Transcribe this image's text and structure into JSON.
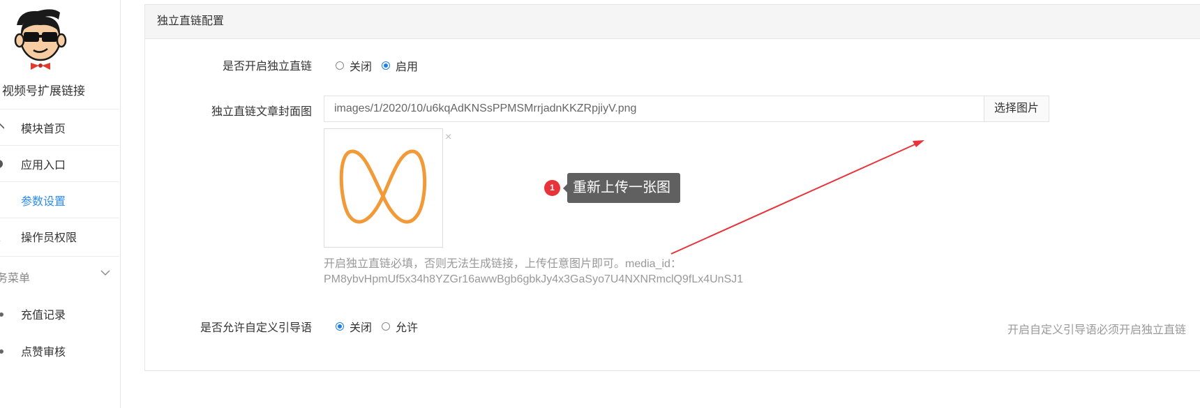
{
  "sidebar": {
    "app_name": "视频号扩展链接",
    "items": [
      {
        "label": "模块首页",
        "icon": "home-icon"
      },
      {
        "label": "应用入口",
        "icon": "circle-icon"
      },
      {
        "label": "参数设置",
        "icon": "settings-dots-icon",
        "active": true
      },
      {
        "label": "操作员权限",
        "icon": "user-icon"
      }
    ],
    "group": {
      "label": "务菜单",
      "icon": "chevron-down-icon"
    },
    "group_items": [
      {
        "label": "充值记录"
      },
      {
        "label": "点赞审核"
      }
    ]
  },
  "panel": {
    "title": "独立直链配置",
    "enable": {
      "label": "是否开启独立直链",
      "options": [
        "关闭",
        "启用"
      ],
      "selected": "启用"
    },
    "cover": {
      "label": "独立直链文章封面图",
      "value": "images/1/2020/10/u6kqAdKNSsPPMSMrrjadnKKZRpjiyV.png",
      "button": "选择图片",
      "remove": "×",
      "help_line1": "开启独立直链必填，否则无法生成链接，上传任意图片即可。media_id：",
      "help_line2": "PM8ybvHpmUf5x34h8YZGr16awwBgb6gbkJy4x3GaSyo7U4NXNRmclQ9fLx4UnSJ1"
    },
    "guide": {
      "label": "是否允许自定义引导语",
      "options": [
        "关闭",
        "允许"
      ],
      "selected": "关闭",
      "help": "开启自定义引导语必须开启独立直链"
    }
  },
  "annotation": {
    "badge": "1",
    "text": "重新上传一张图",
    "badge_color": "#e8333a",
    "arrow_color": "#e8333a"
  },
  "colors": {
    "accent": "#2d8cf0",
    "logo_orange": "#f29a38"
  }
}
